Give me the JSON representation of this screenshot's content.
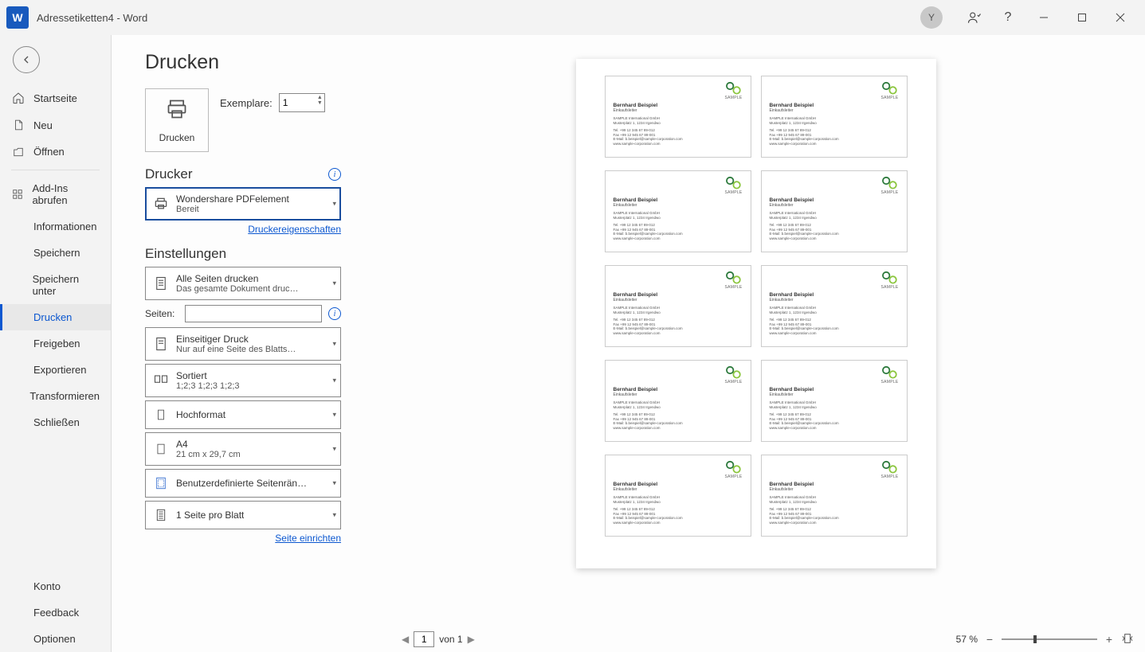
{
  "titleBar": {
    "docTitle": "Adressetiketten4  -  Word",
    "userInitial": "Y"
  },
  "nav": {
    "home": "Startseite",
    "new": "Neu",
    "open": "Öffnen",
    "addins": "Add-Ins abrufen",
    "info": "Informationen",
    "save": "Speichern",
    "saveAs": "Speichern unter",
    "print": "Drucken",
    "share": "Freigeben",
    "export": "Exportieren",
    "transform": "Transformieren",
    "close": "Schließen",
    "account": "Konto",
    "feedback": "Feedback",
    "options": "Optionen"
  },
  "print": {
    "heading": "Drucken",
    "printBtn": "Drucken",
    "copiesLabel": "Exemplare:",
    "copiesValue": "1",
    "printerHeading": "Drucker",
    "printerName": "Wondershare PDFelement",
    "printerStatus": "Bereit",
    "printerPropsLink": "Druckereigenschaften",
    "settingsHeading": "Einstellungen",
    "printWhat1": "Alle Seiten drucken",
    "printWhat2": "Das gesamte Dokument druc…",
    "pagesLabel": "Seiten:",
    "pagesValue": "",
    "sides1": "Einseitiger Druck",
    "sides2": "Nur auf eine Seite des Blatts…",
    "collate1": "Sortiert",
    "collate2": "1;2;3     1;2;3     1;2;3",
    "orientation": "Hochformat",
    "paper1": "A4",
    "paper2": "21 cm x 29,7 cm",
    "margins": "Benutzerdefinierte Seitenrän…",
    "perSheet": "1 Seite pro Blatt",
    "pageSetupLink": "Seite einrichten"
  },
  "preview": {
    "card": {
      "name": "Bernhard Beispiel",
      "role": "Einkaufsleiter",
      "company": "SAMPLE International GmbH",
      "address": "Musterplatz 1, 1234 Irgendwo",
      "phone": "Tel. +99 12 345 67 89-012",
      "fax": "Fax +99 12 945 67 89-001",
      "email": "E-Mail: b.beispiel@sample-corporation.com",
      "web": "www.sample-corporation.com",
      "logoText": "SAMPLE"
    }
  },
  "status": {
    "currentPage": "1",
    "ofText": "von 1",
    "zoomPct": "57 %"
  }
}
